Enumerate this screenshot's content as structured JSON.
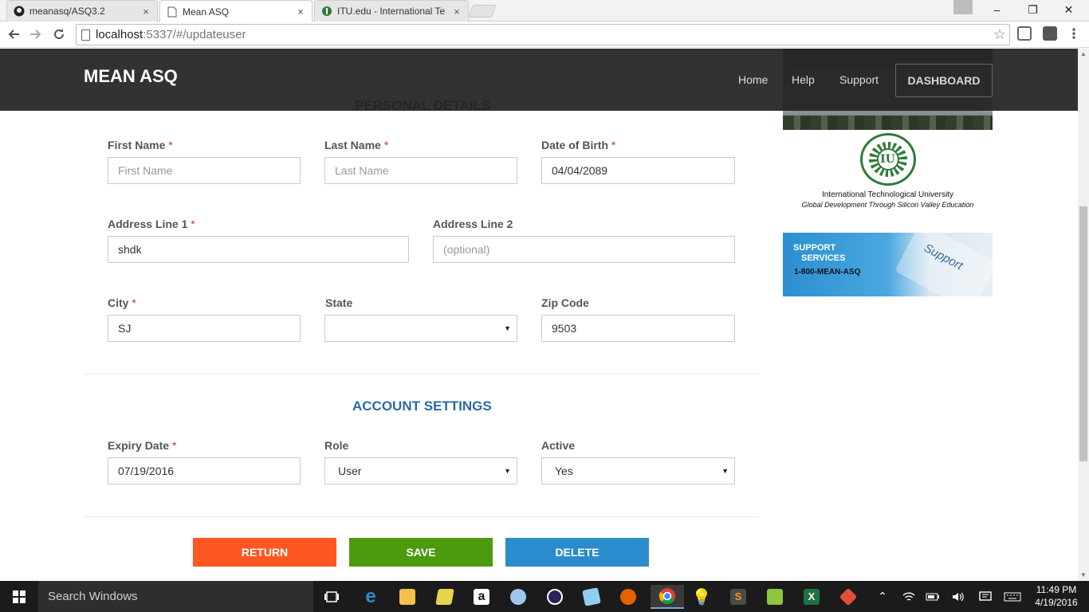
{
  "browser": {
    "tabs": [
      {
        "label": "meanasq/ASQ3.2",
        "icon": "github-icon"
      },
      {
        "label": "Mean ASQ",
        "icon": "page-icon"
      },
      {
        "label": "ITU.edu - International Te",
        "icon": "itu-favicon"
      }
    ],
    "close_glyph": "×",
    "address_host": "localhost",
    "address_rest": ":5337/#/updateuser",
    "window_controls": {
      "minimize": "–",
      "restore": "❐",
      "close": "✕"
    }
  },
  "navbar": {
    "brand": "MEAN ASQ",
    "links": [
      "Home",
      "Help",
      "Support"
    ],
    "dashboard": "DASHBOARD"
  },
  "sidebar": {
    "university_name": "International Technological University",
    "university_tagline": "Global Development Through Silicon Valley Education",
    "seal_text": "IU",
    "support_line1": "SUPPORT",
    "support_line2": "SERVICES",
    "support_phone": "1-800-MEAN-ASQ",
    "support_word": "Support"
  },
  "personal": {
    "title": "PERSONAL DETAILS",
    "required_mark": "*",
    "first_name": {
      "label": "First Name",
      "value": "",
      "placeholder": "First Name"
    },
    "last_name": {
      "label": "Last Name",
      "value": "",
      "placeholder": "Last Name"
    },
    "dob": {
      "label": "Date of Birth",
      "value": "04/04/2089"
    },
    "address1": {
      "label": "Address Line 1",
      "value": "shdk"
    },
    "address2": {
      "label": "Address Line 2",
      "value": "",
      "placeholder": "(optional)"
    },
    "city": {
      "label": "City",
      "value": "SJ"
    },
    "state": {
      "label": "State",
      "value": ""
    },
    "zip": {
      "label": "Zip Code",
      "value": "9503"
    }
  },
  "account": {
    "title": "ACCOUNT SETTINGS",
    "expiry": {
      "label": "Expiry Date",
      "value": "07/19/2016"
    },
    "role": {
      "label": "Role",
      "value": "User"
    },
    "active": {
      "label": "Active",
      "value": "Yes"
    }
  },
  "buttons": {
    "return": "RETURN",
    "save": "SAVE",
    "delete": "DELETE"
  },
  "colors": {
    "return": "#ff5722",
    "save": "#4c9a0e",
    "delete": "#2a8ccc",
    "section_title": "#2a6aa8",
    "navbar": "#222222"
  },
  "taskbar": {
    "search_placeholder": "Search Windows",
    "time": "11:49 PM",
    "date": "4/19/2016"
  }
}
